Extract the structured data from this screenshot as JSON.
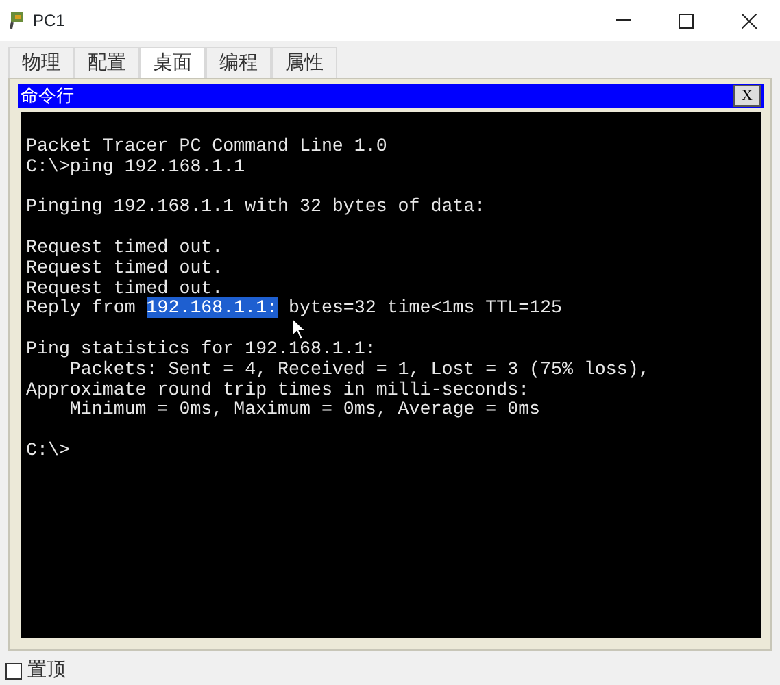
{
  "window": {
    "title": "PC1"
  },
  "tabs": [
    {
      "label": "物理",
      "selected": false
    },
    {
      "label": "配置",
      "selected": false
    },
    {
      "label": "桌面",
      "selected": true
    },
    {
      "label": "编程",
      "selected": false
    },
    {
      "label": "属性",
      "selected": false
    }
  ],
  "panel": {
    "title": "命令行",
    "close_label": "X"
  },
  "terminal": {
    "blocks": [
      [
        {
          "text": "Packet Tracer PC Command Line 1.0"
        },
        {
          "text": "C:\\>ping 192.168.1.1"
        }
      ],
      [
        {
          "text": "Pinging 192.168.1.1 with 32 bytes of data:"
        }
      ],
      [
        {
          "text": "Request timed out."
        },
        {
          "text": "Request timed out."
        },
        {
          "text": "Request timed out."
        },
        {
          "segments": [
            {
              "text": "Reply from ",
              "selected": false
            },
            {
              "text": "192.168.1.1:",
              "selected": true
            },
            {
              "text": " bytes=32 time<1ms TTL=125",
              "selected": false
            }
          ]
        }
      ],
      [
        {
          "text": "Ping statistics for 192.168.1.1:"
        },
        {
          "text": "    Packets: Sent = 4, Received = 1, Lost = 3 (75% loss),"
        },
        {
          "text": "Approximate round trip times in milli-seconds:"
        },
        {
          "text": "    Minimum = 0ms, Maximum = 0ms, Average = 0ms"
        }
      ],
      [
        {
          "text": "C:\\>"
        }
      ]
    ]
  },
  "pin": {
    "label": "置顶",
    "checked": false
  }
}
